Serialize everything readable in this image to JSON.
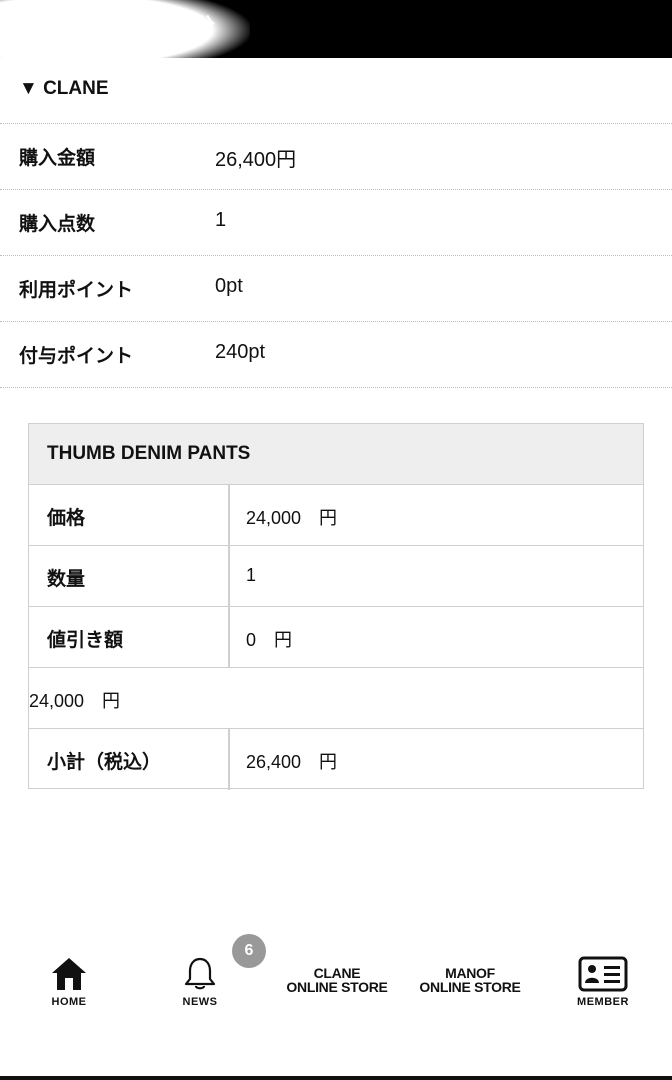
{
  "header": {
    "title": "購入分"
  },
  "section": {
    "label": "▼ CLANE"
  },
  "summary": [
    {
      "key": "購入金額",
      "value": "26,400円"
    },
    {
      "key": "購入点数",
      "value": "1"
    },
    {
      "key": "利用ポイント",
      "value": "0pt"
    },
    {
      "key": "付与ポイント",
      "value": "240pt"
    }
  ],
  "product": {
    "name": "THUMB DENIM PANTS",
    "price_label": "価格",
    "price_value": "24,000　円",
    "qty_label": "数量",
    "qty_value": "1",
    "discount_label": "値引き額",
    "discount_value": "0　円",
    "line_total": "24,000　円",
    "subtotal_label": "小計（税込）",
    "subtotal_value": "26,400　円"
  },
  "tabbar": {
    "home": "HOME",
    "news": "NEWS",
    "news_badge": "6",
    "clane_line1": "CLANE",
    "clane_line2": "ONLINE STORE",
    "manof_line1": "MANOF",
    "manof_line2": "ONLINE STORE",
    "member": "MEMBER"
  },
  "icons": [
    "home-icon",
    "bell-icon",
    "member-card-icon"
  ]
}
